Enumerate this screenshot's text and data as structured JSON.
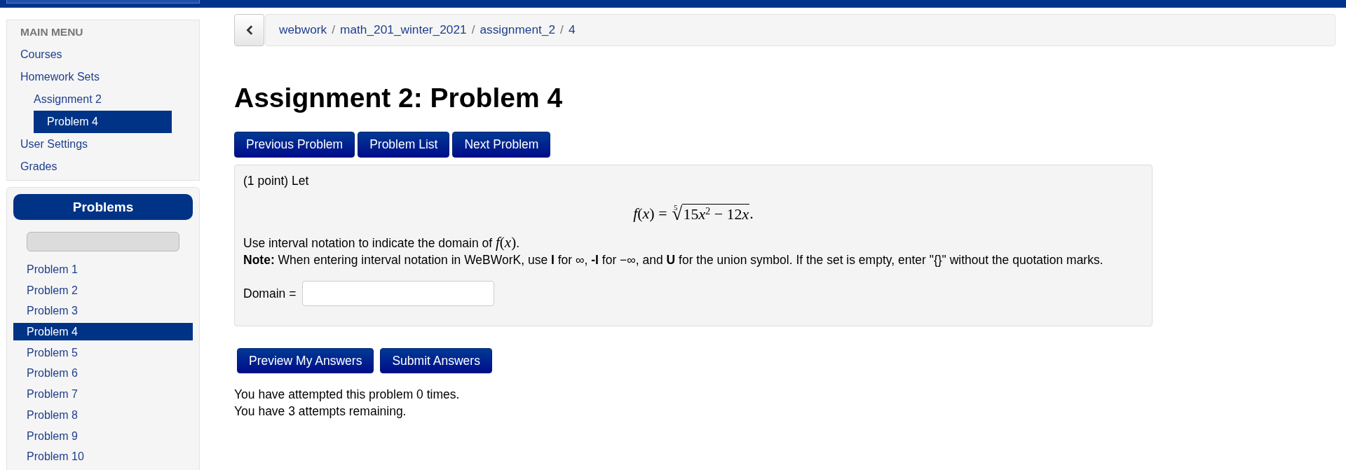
{
  "main_menu": {
    "title": "MAIN MENU",
    "items": [
      {
        "label": "Courses",
        "selected": false
      },
      {
        "label": "Homework Sets",
        "selected": false,
        "children": [
          {
            "label": "Assignment 2",
            "selected": false,
            "children": [
              {
                "label": "Problem 4",
                "selected": true
              }
            ]
          }
        ]
      },
      {
        "label": "User Settings",
        "selected": false
      },
      {
        "label": "Grades",
        "selected": false
      }
    ]
  },
  "problems_panel": {
    "title": "Problems",
    "items": [
      {
        "label": "Problem 1",
        "selected": false
      },
      {
        "label": "Problem 2",
        "selected": false
      },
      {
        "label": "Problem 3",
        "selected": false
      },
      {
        "label": "Problem 4",
        "selected": true
      },
      {
        "label": "Problem 5",
        "selected": false
      },
      {
        "label": "Problem 6",
        "selected": false
      },
      {
        "label": "Problem 7",
        "selected": false
      },
      {
        "label": "Problem 8",
        "selected": false
      },
      {
        "label": "Problem 9",
        "selected": false
      },
      {
        "label": "Problem 10",
        "selected": false
      }
    ]
  },
  "breadcrumb": {
    "items": [
      {
        "label": "webwork"
      },
      {
        "separator": "/",
        "label": "math_201_winter_2021"
      },
      {
        "separator": "/",
        "label": "assignment_2"
      },
      {
        "separator": "/",
        "label": "4"
      }
    ]
  },
  "title": "Assignment 2: Problem 4",
  "nav_buttons": [
    "Previous Problem",
    "Problem List",
    "Next Problem"
  ],
  "problem": {
    "intro": "(1 point) Let",
    "formula": {
      "left": "*f*(*x*) = ",
      "root_index": "5",
      "radical": "√",
      "radicand": [
        {
          "coef": "15",
          "var": "x",
          "exp": "2"
        },
        {
          "op": "−"
        },
        {
          "coef": "12",
          "var": "x"
        }
      ],
      "end": "."
    },
    "instruction": {
      "text": "Use interval notation to indicate the domain of ",
      "math": "*f*(*x*)",
      "end": "."
    },
    "note": "**Note:** When entering interval notation in WeBWorK, use **I** for ∞, **-I** for −∞, and **U** for the union symbol. If the set is empty, enter \"{}\" without the quotation marks.",
    "answer": {
      "label": "Domain ="
    }
  },
  "answer_buttons": [
    "Preview My Answers",
    "Submit Answers"
  ],
  "attempts": [
    "You have attempted this problem 0 times.",
    "You have 3 attempts remaining."
  ]
}
